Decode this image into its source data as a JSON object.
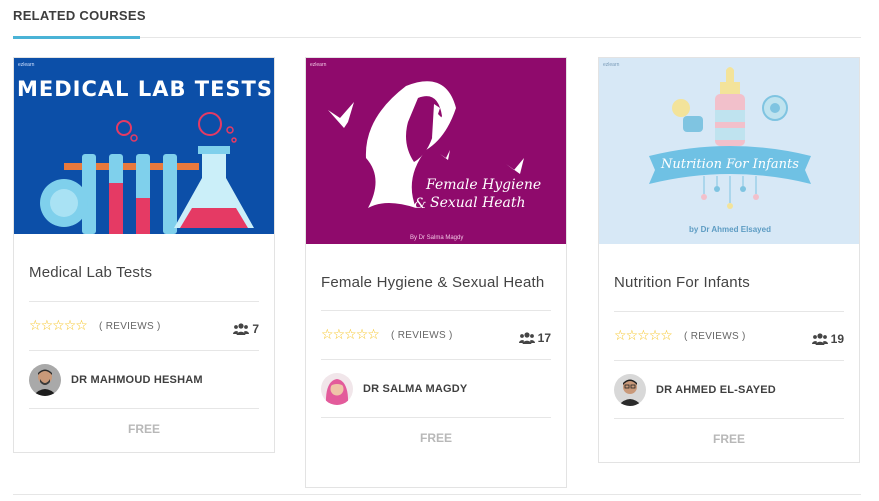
{
  "section": {
    "title": "RELATED COURSES"
  },
  "courses": [
    {
      "image_text": "MEDICAL LAB TESTS",
      "brand": "ezlearn",
      "title": "Medical Lab Tests",
      "reviews_label": "( REVIEWS )",
      "students": "7",
      "instructor": "DR MAHMOUD HESHAM",
      "price": "FREE",
      "rating_stars": 5,
      "accent": "#0c4fa8"
    },
    {
      "image_text_1": "Female Hygiene",
      "image_text_2": "Sexual Heath",
      "image_amp": "&",
      "image_byline": "By Dr Salma Magdy",
      "brand": "ezlearn",
      "title": "Female Hygiene & Sexual Heath",
      "reviews_label": "( REVIEWS )",
      "students": "17",
      "instructor": "DR SALMA MAGDY",
      "price": "FREE",
      "rating_stars": 5,
      "accent": "#8f0a6c"
    },
    {
      "image_text": "Nutrition For Infants",
      "image_byline": "by Dr Ahmed Elsayed",
      "brand": "ezlearn",
      "title": "Nutrition For Infants",
      "reviews_label": "( REVIEWS )",
      "students": "19",
      "instructor": "DR AHMED EL-SAYED",
      "price": "FREE",
      "rating_stars": 5,
      "accent": "#d7e8f6"
    }
  ],
  "colors": {
    "star": "#f6c423",
    "section_underline": "#4ab3d6"
  }
}
